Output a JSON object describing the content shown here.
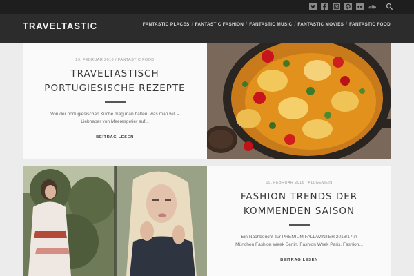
{
  "site": {
    "logo": "TRAVELTASTIC"
  },
  "topbar": {
    "social_icons": [
      "twitter-icon",
      "facebook-icon",
      "instagram-icon",
      "pinterest-icon",
      "flickr-icon",
      "soundcloud-icon"
    ],
    "search_icon": "search-icon"
  },
  "nav": {
    "items": [
      {
        "label": "FANTASTIC PLACES"
      },
      {
        "label": "FANTASTIC FASHION"
      },
      {
        "label": "FANTASTIC MUSIC"
      },
      {
        "label": "FANTASTIC MOVIES"
      },
      {
        "label": "FANTASTIC FOOD"
      }
    ],
    "separator": "/"
  },
  "posts": [
    {
      "meta": "29. FEBRUAR 2016 / FANTASTIC FOOD",
      "title_line1": "TRAVELTASTISCH",
      "title_line2": "PORTUGIESISCHE REZEPTE",
      "excerpt_line1": "Von der portugiesischen Küche mag man halten, was man will –",
      "excerpt_line2": "Liebhaber von Meeresgetier auf...",
      "read_more": "BEITRAG LESEN",
      "image": "food-stew-pan-image"
    },
    {
      "meta": "19. FEBRUAR 2016 / ALLGEMEIN",
      "title_line1": "FASHION TRENDS DER",
      "title_line2": "KOMMENDEN SAISON",
      "excerpt_line1": "Ein Nachbericht zur PREMIUM FALL/WINTER 2016/17 in",
      "excerpt_line2": "München Fashion Week Berlin, Fashion Week Paris, Fashion...",
      "read_more": "BEITRAG LESEN",
      "image": "fashion-models-image"
    }
  ],
  "colors": {
    "topbar": "#1e1e1e",
    "header": "#2c2c2c",
    "card": "#fafafa",
    "page": "#ececec"
  }
}
